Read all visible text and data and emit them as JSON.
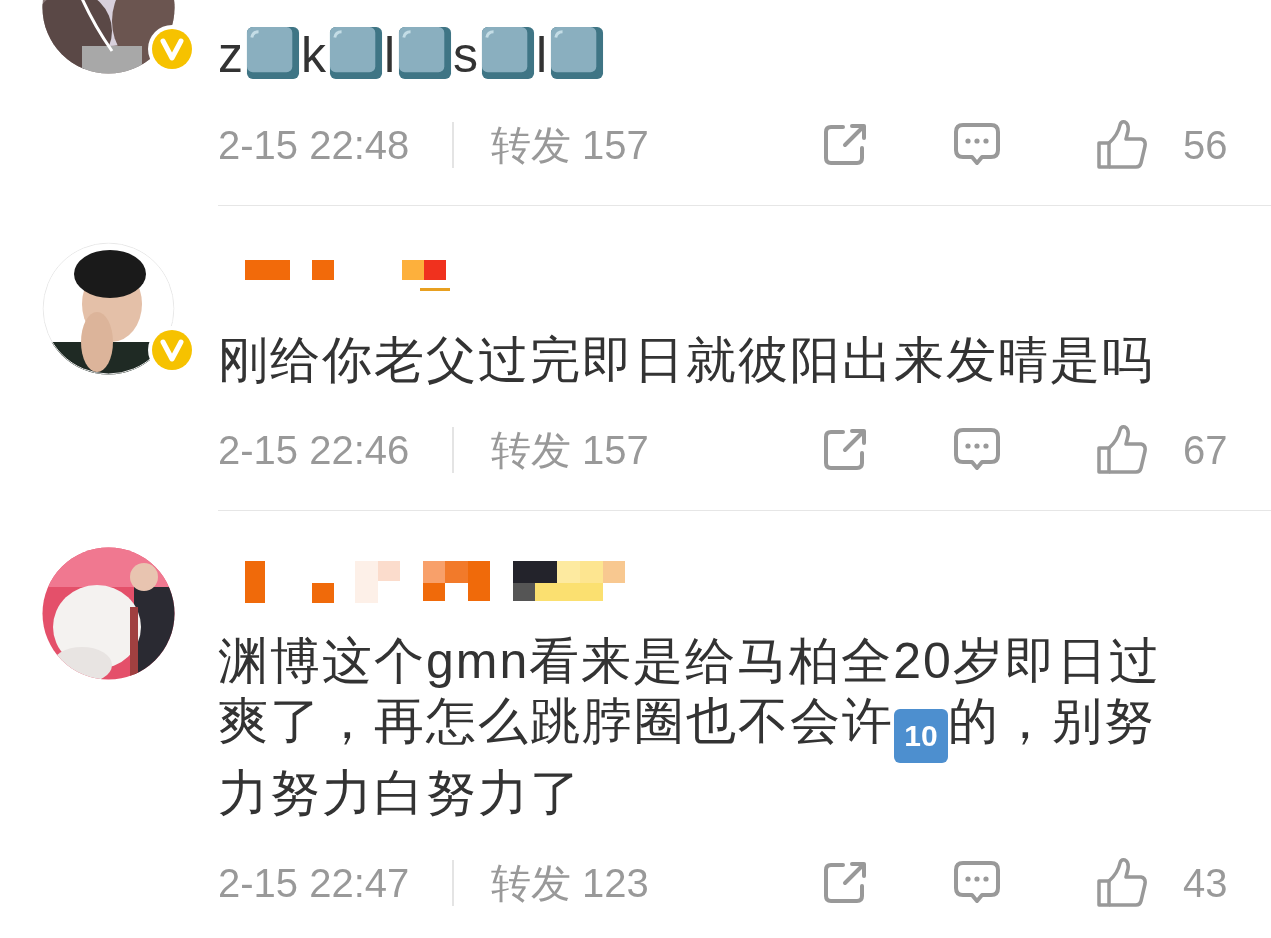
{
  "comments": [
    {
      "verified": true,
      "body": [
        {
          "kind": "text",
          "text": "z"
        },
        {
          "kind": "key"
        },
        {
          "kind": "text",
          "text": "k"
        },
        {
          "kind": "key"
        },
        {
          "kind": "text",
          "text": "l"
        },
        {
          "kind": "key"
        },
        {
          "kind": "text",
          "text": "s"
        },
        {
          "kind": "key"
        },
        {
          "kind": "text",
          "text": "l"
        },
        {
          "kind": "key"
        }
      ],
      "time": "2-15 22:48",
      "repost": "转发 157",
      "likes": "56"
    },
    {
      "verified": true,
      "body": [
        {
          "kind": "text",
          "text": "刚给你老父过完即日就彼阳出来发晴是吗"
        }
      ],
      "time": "2-15 22:46",
      "repost": "转发 157",
      "likes": "67"
    },
    {
      "verified": false,
      "body": [
        {
          "kind": "text",
          "text": "渊博这个gmn看来是给马柏全20岁即日过爽了，再怎么跳脖圈也不会许"
        },
        {
          "kind": "keycap",
          "text": "10"
        },
        {
          "kind": "text",
          "text": "的，别努力努力白努力了"
        }
      ],
      "time": "2-15 22:47",
      "repost": "转发 123",
      "likes": "43"
    }
  ]
}
